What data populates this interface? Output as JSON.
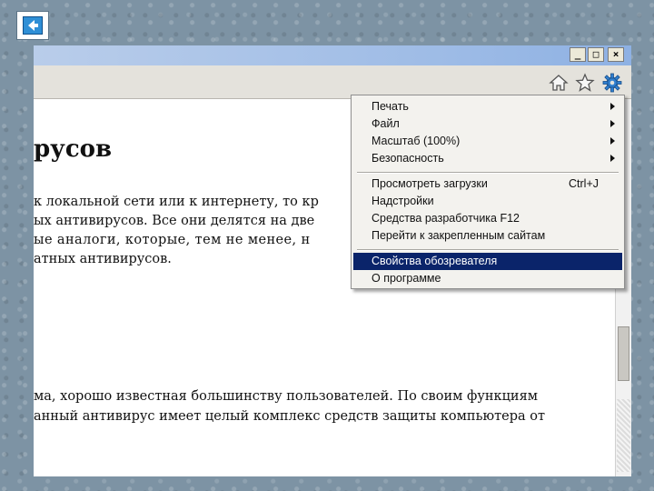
{
  "window_controls": {
    "minimize": "_",
    "maximize": "□",
    "close": "×"
  },
  "toolbar": {
    "icons": [
      "home-icon",
      "star-icon",
      "gear-icon"
    ]
  },
  "page": {
    "heading": "русов",
    "paragraph1": [
      "к локальной сети или к интернету, то кр",
      "ых антивирусов. Все они делятся на две",
      "ые аналоги, которые, тем не менее, н",
      "атных антивирусов."
    ],
    "paragraph2": [
      "ма, хорошо известная большинству пользователей. По своим функциям",
      "анный антивирус имеет целый комплекс средств защиты компьютера от"
    ]
  },
  "menu": {
    "group1": [
      {
        "label": "Печать",
        "submenu": true
      },
      {
        "label": "Файл",
        "submenu": true
      },
      {
        "label": "Масштаб (100%)",
        "submenu": true
      },
      {
        "label": "Безопасность",
        "submenu": true
      }
    ],
    "group2": [
      {
        "label": "Просмотреть загрузки",
        "shortcut": "Ctrl+J"
      },
      {
        "label": "Надстройки"
      },
      {
        "label": "Средства разработчика F12"
      },
      {
        "label": "Перейти к закрепленным сайтам"
      }
    ],
    "group3": [
      {
        "label": "Свойства обозревателя",
        "selected": true
      },
      {
        "label": "О программе"
      }
    ]
  },
  "colors": {
    "selected": "#0a246a",
    "gear": "#2f7fd0",
    "background": "#7d93a4"
  }
}
